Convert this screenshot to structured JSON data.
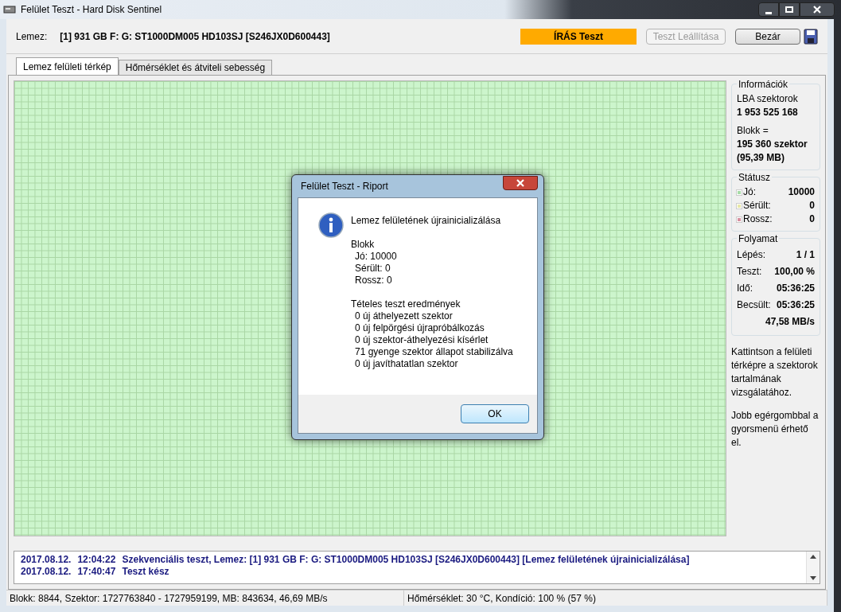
{
  "window": {
    "title": "Felület Teszt - Hard Disk Sentinel"
  },
  "toolbar": {
    "disk_label": "Lemez:",
    "disk_value": "[1] 931 GB F: G: ST1000DM005 HD103SJ [S246JX0D600443]",
    "mode": "ÍRÁS Teszt",
    "buttons": [
      {
        "label": "Teszt Leállítása",
        "disabled": true
      },
      {
        "label": "Bezár",
        "disabled": false
      }
    ]
  },
  "tabs": [
    {
      "label": "Lemez felületi térkép",
      "selected": true
    },
    {
      "label": "Hőmérséklet és átviteli sebesség",
      "selected": false
    }
  ],
  "info": {
    "title": "Információk",
    "lines": [
      {
        "text": "LBA szektorok",
        "kind": "label"
      },
      {
        "text": "1 953 525 168",
        "kind": "value"
      },
      {
        "text": "Blokk =",
        "kind": "label"
      },
      {
        "text": "195 360 szektor",
        "kind": "value"
      },
      {
        "text": "(95,39 MB)",
        "kind": "value"
      }
    ]
  },
  "status": {
    "title": "Státusz",
    "items": [
      {
        "label": "Jó:",
        "value": "10000",
        "color": "#a8dca8"
      },
      {
        "label": "Sérült:",
        "value": "0",
        "color": "#e8e8a8"
      },
      {
        "label": "Rossz:",
        "value": "0",
        "color": "#d890a0"
      }
    ]
  },
  "progress": {
    "title": "Folyamat",
    "rows": [
      {
        "label": "Lépés:",
        "value": "1 / 1"
      },
      {
        "label": "Teszt:",
        "value": "100,00 %"
      },
      {
        "label": "Idő:",
        "value": "05:36:25"
      },
      {
        "label": "Becsült:",
        "value": "05:36:25"
      }
    ],
    "speed": "47,58 MB/s"
  },
  "help": [
    "Kattintson a felületi térképre a szektorok tartalmának vizsgálatához.",
    "Jobb egérgombbal a gyorsmenü érhető el."
  ],
  "dialog": {
    "title": "Felület Teszt - Riport",
    "heading": "Lemez felületének újrainicializálása",
    "sections": [
      {
        "title": "Blokk",
        "lines": [
          "Jó: 10000",
          "Sérült: 0",
          "Rossz: 0"
        ]
      },
      {
        "title": "Tételes teszt eredmények",
        "lines": [
          "0 új áthelyezett szektor",
          "0 új felpörgési újrapróbálkozás",
          "0 új szektor-áthelyezési kísérlet",
          "71 gyenge szektor állapot stabilizálva",
          "0 új javíthatatlan szektor"
        ]
      }
    ],
    "ok": "OK"
  },
  "log": [
    {
      "date": "2017.08.12.",
      "time": "12:04:22",
      "message": "Szekvenciális teszt, Lemez: [1] 931 GB F: G: ST1000DM005 HD103SJ [S246JX0D600443] [Lemez felületének újrainicializálása]"
    },
    {
      "date": "2017.08.12.",
      "time": "17:40:47",
      "message": "Teszt kész"
    }
  ],
  "status_bar": [
    "Blokk: 8844, Szektor: 1727763840 - 1727959199, MB: 843634, 46,69 MB/s",
    "Hőmérséklet: 30  °C,  Kondíció: 100 % (57 %)"
  ]
}
